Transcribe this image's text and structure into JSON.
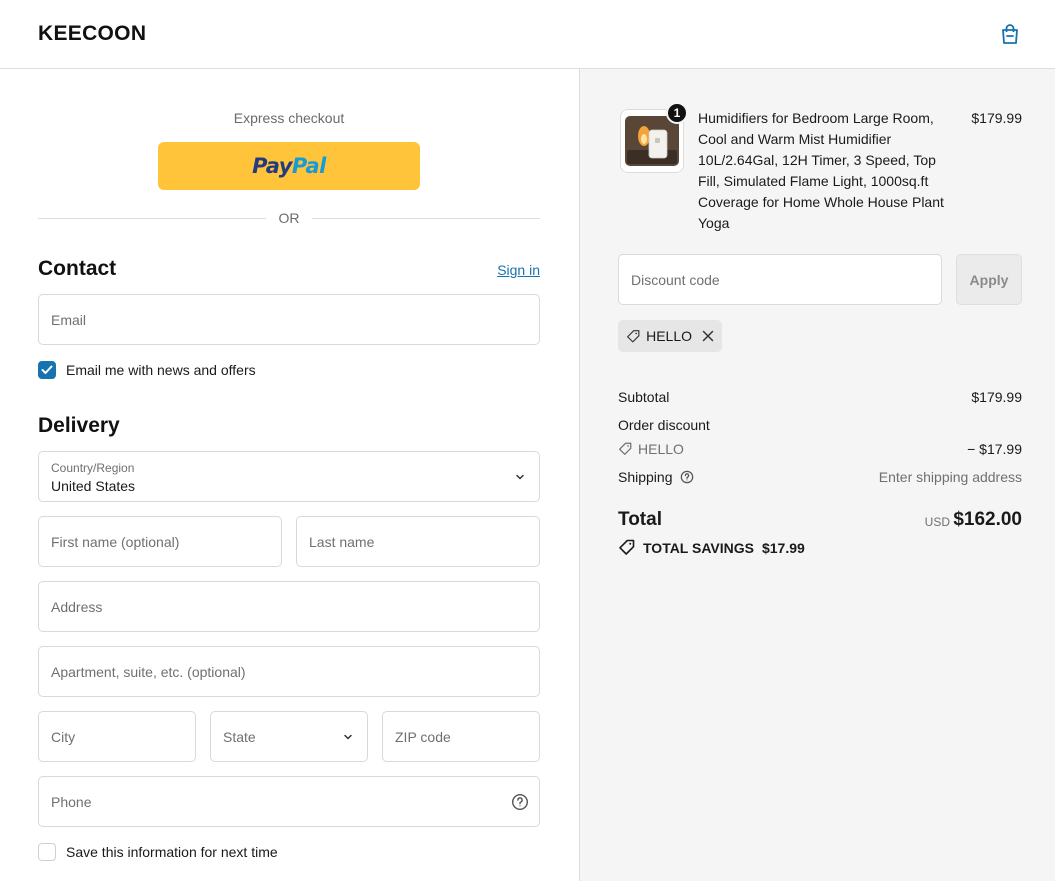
{
  "header": {
    "brand": "KEECOON"
  },
  "express": {
    "label": "Express checkout",
    "paypal_part1": "Pay",
    "paypal_part2": "Pal",
    "divider": "OR"
  },
  "contact": {
    "title": "Contact",
    "signin": "Sign in",
    "email_placeholder": "Email",
    "newsletter_label": "Email me with news and offers",
    "newsletter_checked": true
  },
  "delivery": {
    "title": "Delivery",
    "country_label": "Country/Region",
    "country_value": "United States",
    "first_name_placeholder": "First name (optional)",
    "last_name_placeholder": "Last name",
    "address_placeholder": "Address",
    "apartment_placeholder": "Apartment, suite, etc. (optional)",
    "city_placeholder": "City",
    "state_label": "State",
    "zip_placeholder": "ZIP code",
    "phone_placeholder": "Phone",
    "save_info_label": "Save this information for next time",
    "save_info_checked": false
  },
  "order": {
    "product_title": "Humidifiers for Bedroom Large Room, Cool and Warm Mist Humidifier 10L/2.64Gal, 12H Timer, 3 Speed, Top Fill, Simulated Flame Light, 1000sq.ft Coverage for Home Whole House Plant Yoga",
    "product_price": "$179.99",
    "quantity": "1",
    "discount_placeholder": "Discount code",
    "apply_label": "Apply",
    "applied_code": "HELLO",
    "subtotal_label": "Subtotal",
    "subtotal_value": "$179.99",
    "order_discount_label": "Order discount",
    "discount_code_label": "HELLO",
    "discount_value": "− $17.99",
    "shipping_label": "Shipping",
    "shipping_value": "Enter shipping address",
    "total_label": "Total",
    "currency": "USD",
    "total_value": "$162.00",
    "savings_label": "TOTAL SAVINGS",
    "savings_value": "$17.99"
  },
  "colors": {
    "accent": "#1773b0",
    "paypal_yellow": "#ffc439",
    "sidebar_bg": "#f5f5f5"
  },
  "icons": {
    "cart": "shopping-bag-icon",
    "select": "chevron-down-icon",
    "phone_help": "help-circle-icon",
    "tag": "tag-icon",
    "remove": "close-icon",
    "savings": "tags-icon"
  }
}
